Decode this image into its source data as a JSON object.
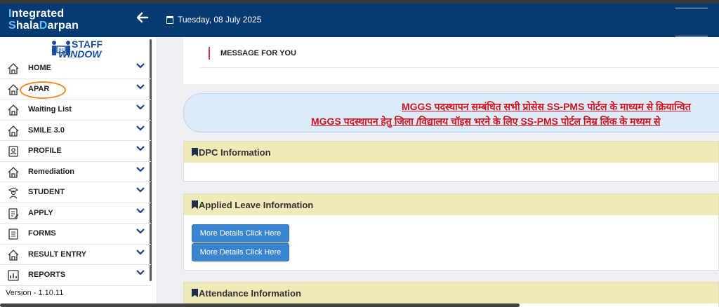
{
  "header": {
    "logo_line1_initial": "I",
    "logo_line1_rest": "ntegrated",
    "logo_line2_a": "S",
    "logo_line2_b": "hala",
    "logo_line2_c": "D",
    "logo_line2_d": "arpan",
    "back_icon": "left-arrow-icon",
    "date": "Tuesday, 08 July 2025",
    "bg_color": "#063a73"
  },
  "sidebar": {
    "logo_line1": "STAFF",
    "logo_line2": "WINDOW",
    "items": [
      {
        "label": "HOME",
        "icon": "home-icon"
      },
      {
        "label": "APAR",
        "icon": "home-icon"
      },
      {
        "label": "Waiting List",
        "icon": "home-icon"
      },
      {
        "label": "SMILE 3.0",
        "icon": "home-icon"
      },
      {
        "label": "PROFILE",
        "icon": "profile-icon"
      },
      {
        "label": "Remediation",
        "icon": "home-icon"
      },
      {
        "label": "STUDENT",
        "icon": "student-icon"
      },
      {
        "label": "APPLY",
        "icon": "apply-icon"
      },
      {
        "label": "FORMS",
        "icon": "forms-icon"
      },
      {
        "label": "RESULT ENTRY",
        "icon": "home-icon"
      },
      {
        "label": "REPORTS",
        "icon": "reports-icon"
      }
    ],
    "version": "Version - 1.10.11"
  },
  "main": {
    "message_title": "MESSAGE FOR YOU",
    "notice_line1": "MGGS पदस्थापन सम्बंधित सभी प्रोसेस SS-PMS पोर्टल के माध्यम से क्रियान्वित",
    "notice_line2": "MGGS पदस्थापन हेतु जिला /विद्यालय चॉइस भरने के लिए SS-PMS पोर्टल निम्र लिंक के मध्यम से",
    "cards": {
      "dpc": "DPC Information",
      "leave": "Applied Leave Information",
      "attendance": "Attendance Information"
    },
    "buttons": {
      "details1": "More Details Click Here",
      "details2": "More Details Click Here"
    },
    "accent_red": "#d0141d",
    "button_color": "#3a85d0"
  }
}
